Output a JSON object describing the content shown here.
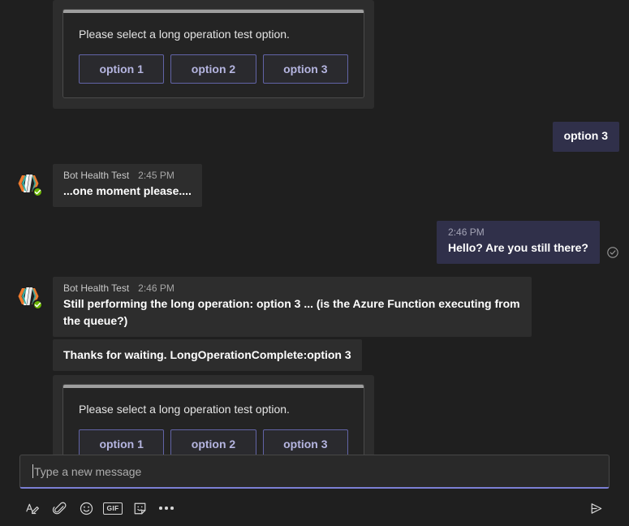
{
  "colors": {
    "app_background": "#1f1f1f",
    "bot_bubble": "#2d2d2d",
    "user_bubble": "#30304a",
    "card_outer": "#2d2d2d",
    "card_inner": "#242424",
    "card_accent": "#9e9e9e",
    "action_accent": "#6264a7",
    "action_text": "#b5b5e0",
    "compose_focus_underline": "#7b7fd4",
    "presence_available": "#6bb700"
  },
  "messages": [
    {
      "id": "card-1",
      "type": "adaptive-card",
      "author": "",
      "card": {
        "text": "Please select a long operation test option.",
        "actions": [
          {
            "label": "option 1"
          },
          {
            "label": "option 2"
          },
          {
            "label": "option 3"
          }
        ]
      }
    },
    {
      "id": "user-1",
      "type": "user",
      "timestamp": "",
      "text": "option 3",
      "has_receipt": false
    },
    {
      "id": "bot-1",
      "type": "bot",
      "sender": "Bot Health Test",
      "timestamp": "2:45 PM",
      "text": "...one moment please...."
    },
    {
      "id": "user-2",
      "type": "user",
      "timestamp": "2:46 PM",
      "text": "Hello? Are you still there?",
      "has_receipt": true
    },
    {
      "id": "bot-2",
      "type": "bot",
      "sender": "Bot Health Test",
      "timestamp": "2:46 PM",
      "text": "Still performing the long operation: option 3 ... (is the Azure Function executing from the queue?)"
    },
    {
      "id": "bot-3",
      "type": "bot-followup",
      "text": "Thanks for waiting. LongOperationComplete:option 3"
    },
    {
      "id": "card-2",
      "type": "adaptive-card",
      "card": {
        "text": "Please select a long operation test option.",
        "actions": [
          {
            "label": "option 1"
          },
          {
            "label": "option 2"
          },
          {
            "label": "option 3"
          }
        ]
      }
    }
  ],
  "compose": {
    "placeholder": "Type a new message",
    "value": "",
    "tools": [
      {
        "name": "format-icon",
        "label": "Format"
      },
      {
        "name": "attach-icon",
        "label": "Attach"
      },
      {
        "name": "emoji-icon",
        "label": "Emoji"
      },
      {
        "name": "gif-icon",
        "label": "GIF"
      },
      {
        "name": "sticker-icon",
        "label": "Sticker"
      },
      {
        "name": "more-options-icon",
        "label": "More options"
      }
    ],
    "send_label": "Send"
  },
  "avatar": {
    "alt": "Bot Health Test",
    "presence": "Available"
  }
}
